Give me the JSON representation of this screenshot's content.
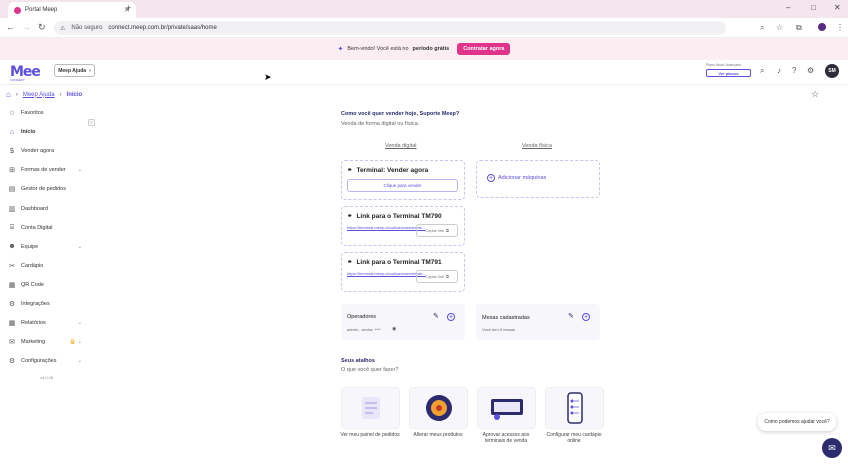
{
  "browser": {
    "tab_title": "Portal Meep",
    "new_tab": "+",
    "security_label": "Não seguro",
    "url": "connect.meep.com.br/private/saas/home",
    "window_controls": [
      "–",
      "□",
      "✕"
    ]
  },
  "banner": {
    "text_prefix": "Bem-vindo! Você está no",
    "text_bold": "período grátis",
    "button": "Contratar agora"
  },
  "header": {
    "logo": "Mee",
    "logo_sub": "CONNECT",
    "help_button": "Meep Ajuda",
    "plan_label": "Plano Atual: Avançado",
    "plan_button": "Ver planos",
    "avatar_initials": "SM"
  },
  "breadcrumb": {
    "items": [
      "Meep Ajuda",
      "Início"
    ]
  },
  "sidebar": {
    "items": [
      {
        "label": "Favoritos",
        "icon": "star-icon"
      },
      {
        "label": "Início",
        "icon": "home-icon",
        "active": true
      },
      {
        "label": "Vender agora",
        "icon": "dollar-icon"
      },
      {
        "label": "Formas de vender",
        "icon": "cart-icon",
        "chevron": true
      },
      {
        "label": "Gestor de pedidos",
        "icon": "orders-icon"
      },
      {
        "label": "Dashboard",
        "icon": "dashboard-icon"
      },
      {
        "label": "Conta Digital",
        "icon": "bank-icon"
      },
      {
        "label": "Equipe",
        "icon": "team-icon",
        "chevron": true
      },
      {
        "label": "Cardápio",
        "icon": "menu-icon"
      },
      {
        "label": "QR Code",
        "icon": "qrcode-icon"
      },
      {
        "label": "Integrações",
        "icon": "integrations-icon"
      },
      {
        "label": "Relatórios",
        "icon": "reports-icon",
        "chevron": true
      },
      {
        "label": "Marketing",
        "icon": "marketing-icon",
        "chevron": true,
        "crown": true
      },
      {
        "label": "Configurações",
        "icon": "settings-icon",
        "chevron": true
      }
    ],
    "version": "v4.0.26"
  },
  "main": {
    "question": "Como você quer vender hoje, Suporte Meep?",
    "question_sub": "Venda de forma digital ou física.",
    "digital_label": "Venda digital",
    "physical_label": "Venda física",
    "terminal_vender": {
      "title": "Terminal: Vender agora",
      "button": "Clique para vender"
    },
    "terminal_link_1": {
      "title": "Link para o Terminal TM790",
      "link": "https://terminal.meep.cloud/saveacenfante...",
      "copy": "Copiar link"
    },
    "terminal_link_2": {
      "title": "Link para o Terminal TM791",
      "link": "https://terminal.meep.cloud/saveacenfante...",
      "copy": "Copiar link"
    },
    "add_machines": "Adicionar máquinas",
    "operators": {
      "title": "Operadores",
      "line": "admin - senha: ****"
    },
    "tables": {
      "title": "Mesas cadastradas",
      "line": "Você tem 0 mesas."
    },
    "shortcuts_title": "Seus atalhos",
    "shortcuts_sub": "O que você quer fazer?",
    "shortcuts": [
      {
        "label": "Ver meu painel de pedidos"
      },
      {
        "label": "Alterar meus produtos"
      },
      {
        "label": "Aprovar acessos aos terminais de venda"
      },
      {
        "label": "Configurar meu cardápio online"
      }
    ]
  },
  "chat": {
    "bubble": "Como podemos ajudar você?"
  },
  "colors": {
    "accent": "#5b4ee0",
    "brand_pink": "#e0338a",
    "navy": "#2b2b6e"
  }
}
